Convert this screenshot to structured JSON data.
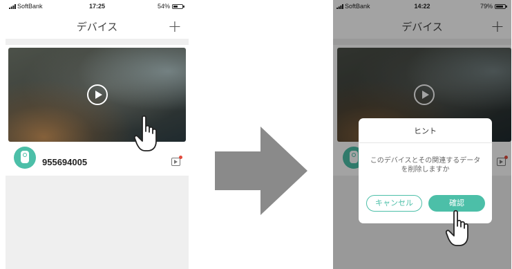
{
  "before": {
    "status": {
      "carrier": "SoftBank",
      "time": "17:25",
      "battery": "54%",
      "battery_level": 0.54
    },
    "nav": {
      "title": "デバイス",
      "add": "+"
    },
    "device": {
      "id": "955694005"
    }
  },
  "after": {
    "status": {
      "carrier": "SoftBank",
      "time": "14:22",
      "battery": "79%",
      "battery_level": 0.79
    },
    "nav": {
      "title": "デバイス",
      "add": "+"
    },
    "dialog": {
      "title": "ヒント",
      "message": "このデバイスとその関連するデータを削除しますか",
      "cancel": "キャンセル",
      "confirm": "確認"
    }
  },
  "colors": {
    "accent": "#4cbfa8",
    "badge": "#e24a3c",
    "arrow": "#8a8a8a"
  }
}
